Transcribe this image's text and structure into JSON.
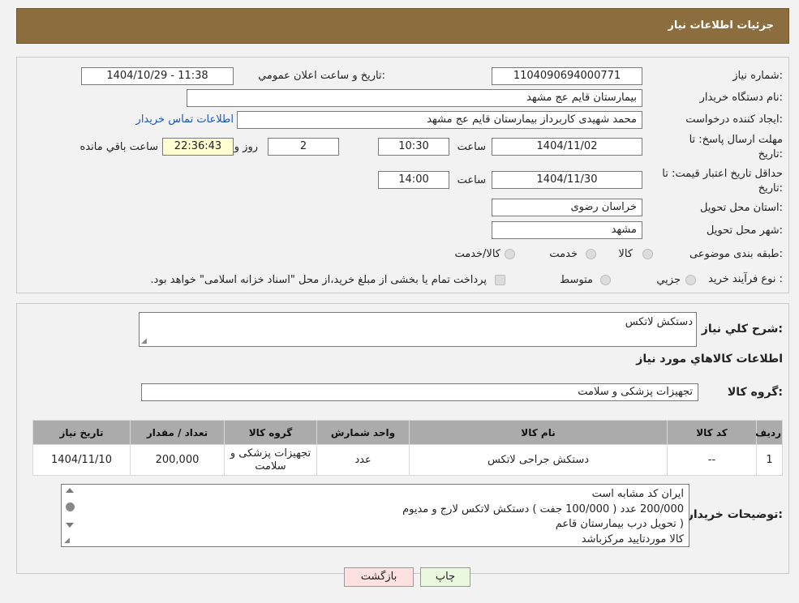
{
  "header": {
    "title": "جزئیات اطلاعات نیاز"
  },
  "form": {
    "need_number_label": "شماره نیاز:",
    "need_number": "1104090694000771",
    "announce_label": "تاریخ و ساعت اعلان عمومي:",
    "announce_value": "1404/10/29 - 11:38",
    "buyer_org_label": "نام دستگاه خریدار:",
    "buyer_org": "بیمارستان قایم  عج  مشهد",
    "requester_label": "ایجاد کننده درخواست:",
    "requester": "محمد شهیدی کاربرداز بیمارستان قایم  عج  مشهد",
    "contact_link": "اطلاعات تماس خریدار",
    "deadline_label_1": "مهلت ارسال پاسخ: تا",
    "deadline_label_2": "تاریخ:",
    "deadline_date": "1404/11/02",
    "time_label": "ساعت",
    "deadline_time": "10:30",
    "days_value": "2",
    "days_label": "روز و",
    "remaining_value": "22:36:43",
    "remaining_label": "ساعت باقي مانده",
    "validity_label_1": "حداقل تاریخ اعتبار قیمت: تا",
    "validity_label_2": "تاریخ:",
    "validity_date": "1404/11/30",
    "validity_time": "14:00",
    "province_label": "استان محل تحویل:",
    "province": "خراسان رضوی",
    "city_label": "شهر محل تحویل:",
    "city": "مشهد",
    "category_label": "طبقه بندی موضوعی:",
    "category_options": [
      "کالا",
      "خدمت",
      "کالا/خدمت"
    ],
    "process_label": "نوع فرآیند خرید :",
    "process_options": [
      "جزیي",
      "متوسط"
    ],
    "process_note": "پرداخت تمام یا بخشی از مبلغ خرید،از محل \"اسناد خزانه اسلامی\" خواهد بود."
  },
  "description": {
    "label": "شرح كلي نياز:",
    "value": "دستکش لاتکس",
    "items_title": "اطلاعات كالاهاي مورد نياز",
    "group_label": "گروه كالا:",
    "group_value": "تجهیزات پزشکی و سلامت"
  },
  "table": {
    "headers": [
      "رديف",
      "كد كالا",
      "نام كالا",
      "واحد شمارش",
      "گروه كالا",
      "تعداد / مقدار",
      "تاريخ نياز"
    ],
    "rows": [
      [
        "1",
        "--",
        "دستکش جراحی لاتکس",
        "عدد",
        "تجهیزات پزشکی و سلامت",
        "200,000",
        "1404/11/10"
      ]
    ]
  },
  "buyer_notes": {
    "label": "توضيحات خريدار:",
    "lines": [
      "ایران  کد مشابه است",
      "200/000 عدد  ( 100/000 جفت ) دستکش  لاتکس لارج و مدیوم",
      "( تحویل درب بیمارستان قاعم",
      "کالا  موردتایید مرکزباشد"
    ]
  },
  "buttons": {
    "print": "چاپ",
    "back": "بازگشت"
  },
  "colors": {
    "header": "#8b6d3e",
    "print_button": "#eaf8e0",
    "back_button": "#fde0e0",
    "link": "#1a56b8"
  }
}
